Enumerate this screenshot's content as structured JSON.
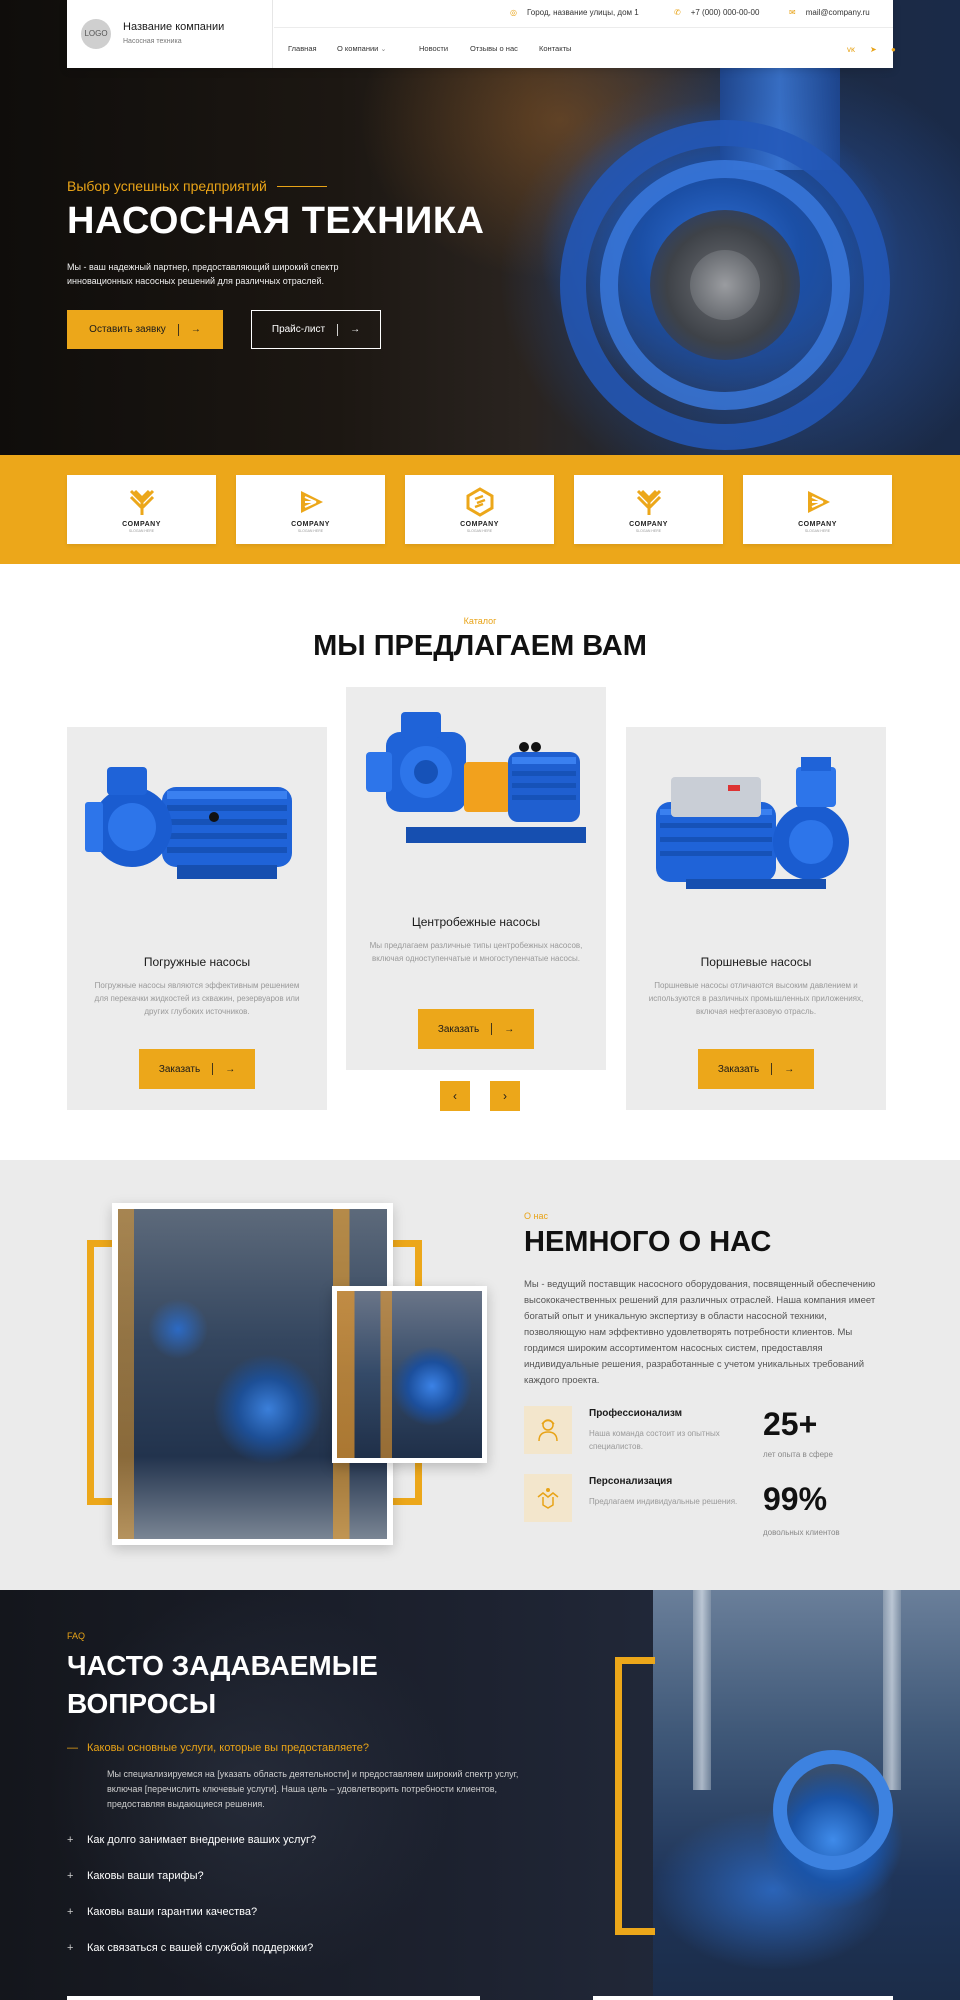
{
  "header": {
    "logo_text": "LOGO",
    "company_name": "Название компании",
    "company_tagline": "Насосная техника",
    "address": "Город, название улицы, дом 1",
    "phone": "+7 (000) 000-00-00",
    "email": "mail@company.ru",
    "nav": [
      {
        "label": "Главная"
      },
      {
        "label": "О компании"
      },
      {
        "label": "Новости"
      },
      {
        "label": "Отзывы о нас"
      },
      {
        "label": "Контакты"
      }
    ]
  },
  "hero": {
    "kicker": "Выбор успешных предприятий",
    "title": "НАСОСНАЯ ТЕХНИКА",
    "description": "Мы - ваш надежный партнер, предоставляющий широкий спектр инновационных насосных решений для различных отраслей.",
    "primary_button": "Оставить заявку",
    "secondary_button": "Прайс-лист"
  },
  "clients": [
    {
      "name": "COMPANY",
      "slogan": "SLOGAN HERE",
      "icon": "wheat-logo-icon"
    },
    {
      "name": "COMPANY",
      "slogan": "SLOGAN HERE",
      "icon": "triangle-logo-icon"
    },
    {
      "name": "COMPANY",
      "slogan": "SLOGAN HERE",
      "icon": "hexagon-logo-icon"
    },
    {
      "name": "COMPANY",
      "slogan": "SLOGAN HERE",
      "icon": "wheat-logo-icon"
    },
    {
      "name": "COMPANY",
      "slogan": "SLOGAN HERE",
      "icon": "triangle-logo-icon"
    }
  ],
  "catalog": {
    "kicker": "Каталог",
    "title": "МЫ ПРЕДЛАГАЕМ ВАМ",
    "products": [
      {
        "name": "Погружные насосы",
        "description": "Погружные насосы являются эффективным решением для перекачки жидкостей из скважин, резервуаров или других глубоких источников.",
        "button": "Заказать"
      },
      {
        "name": "Центробежные насосы",
        "description": "Мы предлагаем различные типы центробежных насосов, включая одноступенчатые и многоступенчатые насосы.",
        "button": "Заказать"
      },
      {
        "name": "Поршневые насосы",
        "description": "Поршневые насосы отличаются высоким давлением и используются в различных промышленных приложениях, включая нефтегазовую отрасль.",
        "button": "Заказать"
      }
    ]
  },
  "about": {
    "kicker": "О нас",
    "title": "НЕМНОГО О НАС",
    "text": "Мы - ведущий поставщик насосного оборудования, посвященный обеспечению высококачественных решений для различных отраслей. Наша компания имеет богатый опыт и уникальную экспертизу в области насосной техники, позволяющую нам эффективно удовлетворять потребности клиентов. Мы гордимся широким ассортиментом насосных систем, предоставляя индивидуальные решения, разработанные с учетом уникальных требований каждого проекта.",
    "features": [
      {
        "title": "Профессионализм",
        "description": "Наша команда состоит из опытных специалистов.",
        "icon": "engineer-icon"
      },
      {
        "title": "Персонализация",
        "description": "Предлагаем индивидуальные решения.",
        "icon": "handshake-icon"
      }
    ],
    "stats": [
      {
        "value": "25+",
        "label": "лет опыта в сфере"
      },
      {
        "value": "99%",
        "label": "довольных клиентов"
      }
    ]
  },
  "faq": {
    "kicker": "FAQ",
    "title": "ЧАСТО ЗАДАВАЕМЫЕ ВОПРОСЫ",
    "items": [
      {
        "question": "Каковы основные услуги, которые вы предоставляете?",
        "answer": "Мы специализируемся на [указать область деятельности] и предоставляем широкий спектр услуг, включая [перечислить ключевые услуги]. Наша цель – удовлетворить потребности клиентов, предоставляя выдающиеся решения.",
        "sign": "—"
      },
      {
        "question": "Как долго занимает внедрение ваших услуг?",
        "sign": "+"
      },
      {
        "question": "Каковы ваши тарифы?",
        "sign": "+"
      },
      {
        "question": "Каковы ваши гарантии качества?",
        "sign": "+"
      },
      {
        "question": "Как связаться с вашей службой поддержки?",
        "sign": "+"
      }
    ]
  },
  "colors": {
    "accent": "#eca71a",
    "dark": "#111111",
    "card": "#ececec",
    "section_gray": "#ebebeb"
  }
}
